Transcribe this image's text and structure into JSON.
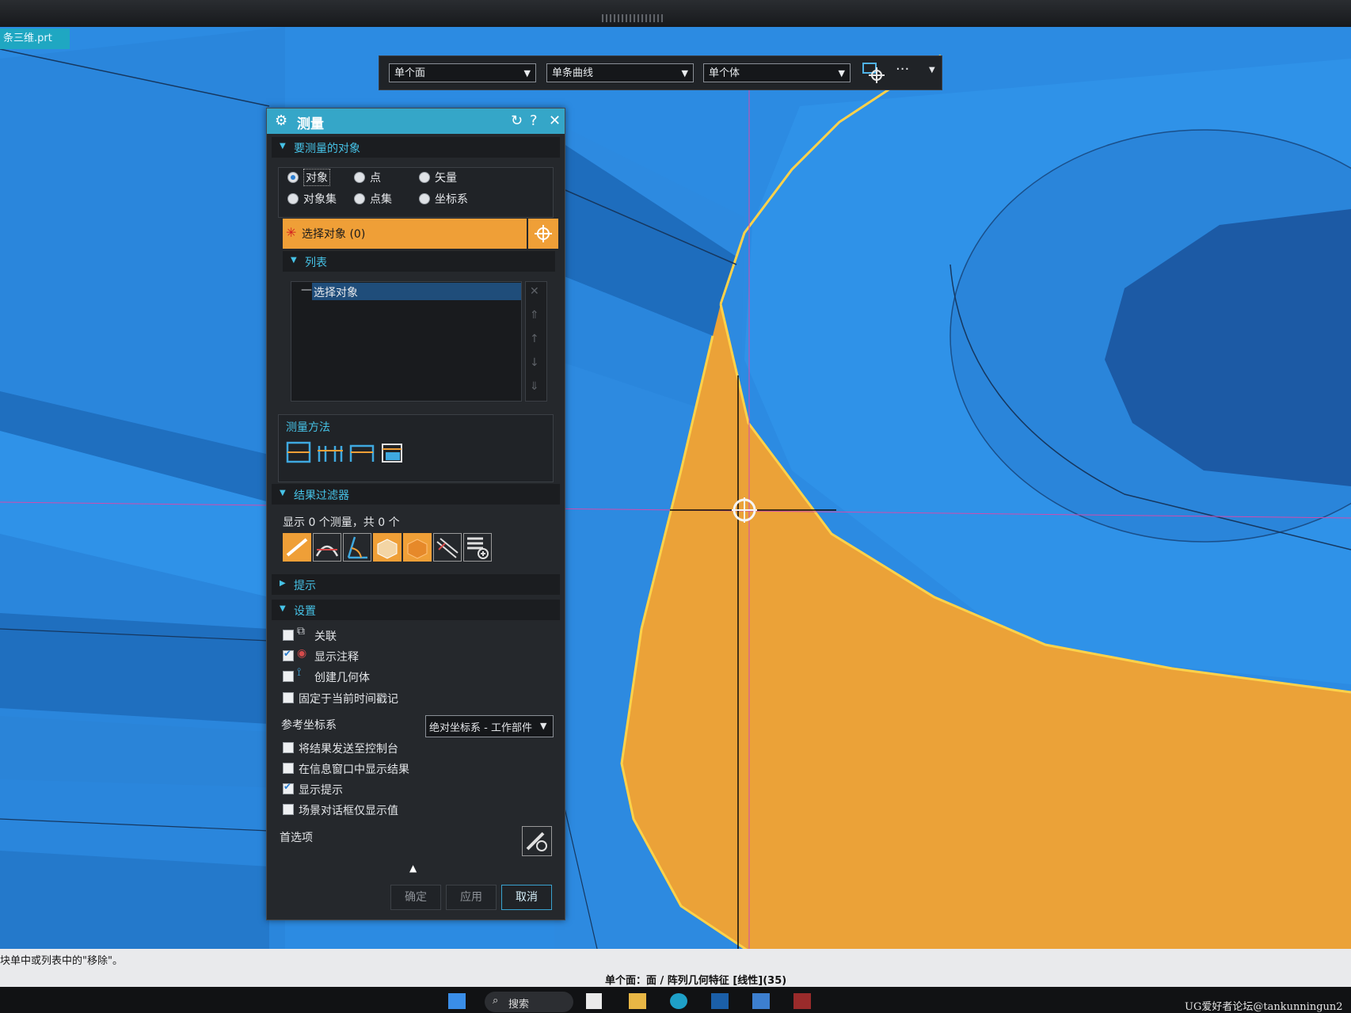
{
  "file_tab": "条三维.prt",
  "selection_bar": {
    "combo1": "单个面",
    "combo2": "单条曲线",
    "combo3": "单个体",
    "more_label": "···"
  },
  "dialog": {
    "title": "测量",
    "section_objects": "要测量的对象",
    "radio_object": "对象",
    "radio_point": "点",
    "radio_vector": "矢量",
    "radio_object_set": "对象集",
    "radio_point_set": "点集",
    "radio_csys": "坐标系",
    "select_object": "选择对象 (0)",
    "section_list": "列表",
    "list_item": "选择对象",
    "measure_method": "测量方法",
    "section_result_filter": "结果过滤器",
    "result_count": "显示 0 个测量，共 0 个",
    "section_hint": "提示",
    "section_settings": "设置",
    "chk_associate": "关联",
    "chk_show_annotation": "显示注释",
    "chk_create_geometry": "创建几何体",
    "chk_fix_timestamp": "固定于当前时间戳记",
    "ref_csys_label": "参考坐标系",
    "ref_csys_value": "绝对坐标系 - 工作部件",
    "chk_send_console": "将结果发送至控制台",
    "chk_info_window": "在信息窗口中显示结果",
    "chk_show_hint": "显示提示",
    "chk_scene_values": "场景对话框仅显示值",
    "preferences": "首选项",
    "ok": "确定",
    "apply": "应用",
    "cancel": "取消"
  },
  "status": {
    "left": "块单中或列表中的\"移除\"。",
    "center": "单个面：面 / 阵列几何特征 [线性](35)"
  },
  "taskbar": {
    "search": "搜索",
    "watermark": "UG爱好者论坛@tankunningun2"
  },
  "colors": {
    "accent": "#35a6c8",
    "highlight": "#f0a436",
    "viewport_blue": "#2c8be2"
  }
}
